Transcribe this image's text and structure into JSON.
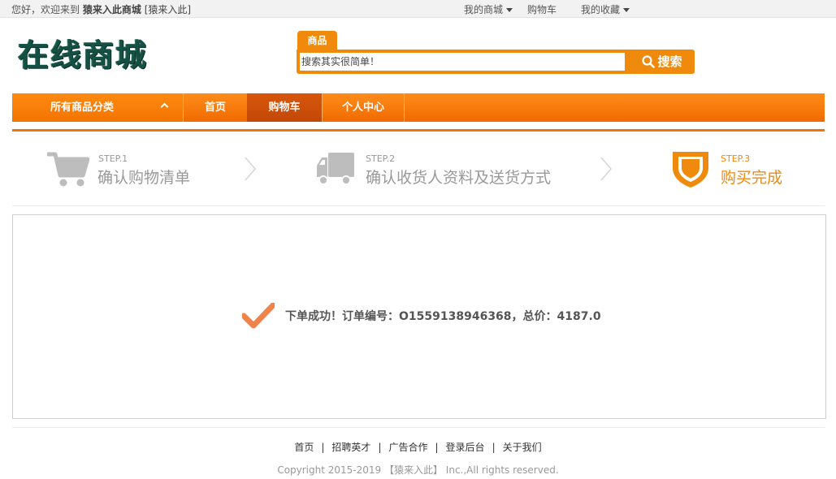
{
  "topbar": {
    "welcome_prefix": "您好，欢迎来到",
    "shop_name": "猿来入此商城",
    "user_name": "[猿来入此]",
    "links": [
      {
        "label": "我的商城",
        "dropdown": true
      },
      {
        "label": "购物车",
        "dropdown": false
      },
      {
        "label": "我的收藏",
        "dropdown": true
      }
    ]
  },
  "logo": {
    "text": "在线商城"
  },
  "search": {
    "tab_label": "商品",
    "placeholder": "搜索其实很简单！",
    "button_label": "搜索"
  },
  "nav": {
    "category_label": "所有商品分类",
    "items": [
      {
        "label": "首页",
        "active": false
      },
      {
        "label": "购物车",
        "active": true
      },
      {
        "label": "个人中心",
        "active": false
      }
    ]
  },
  "steps": [
    {
      "step": "STEP.1",
      "label": "确认购物清单",
      "icon": "cart-icon",
      "done": false
    },
    {
      "step": "STEP.2",
      "label": "确认收货人资料及送货方式",
      "icon": "truck-icon",
      "done": false
    },
    {
      "step": "STEP.3",
      "label": "购买完成",
      "icon": "shield-icon",
      "done": true
    }
  ],
  "result": {
    "message": "下单成功！订单编号：O1559138946368，总价：4187.0"
  },
  "footer": {
    "links": [
      "首页",
      "招聘英才",
      "广告合作",
      "登录后台",
      "关于我们"
    ],
    "copyright": "Copyright 2015-2019 【猿来入此】 Inc.,All rights reserved."
  },
  "colors": {
    "accent": "#f08a0c",
    "nav_active": "#c8500a",
    "logo": "#155045"
  }
}
